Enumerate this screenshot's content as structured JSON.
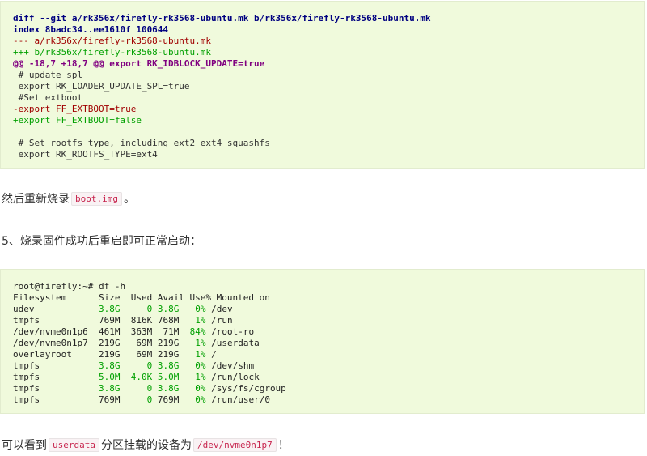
{
  "diff": {
    "header1": "diff --git a/rk356x/firefly-rk3568-ubuntu.mk b/rk356x/firefly-rk3568-ubuntu.mk",
    "header2": "index 8badc34..ee1610f 100644",
    "old_file": "--- a/rk356x/firefly-rk3568-ubuntu.mk",
    "new_file": "+++ b/rk356x/firefly-rk3568-ubuntu.mk",
    "hunk": "@@ -18,7 +18,7 @@ export RK_IDBLOCK_UPDATE=true",
    "ctx1": " # update spl",
    "ctx2": " export RK_LOADER_UPDATE_SPL=true",
    "ctx3": " #Set extboot",
    "del1": "-export FF_EXTBOOT=true",
    "add1": "+export FF_EXTBOOT=false",
    "ctx4": "",
    "ctx5": " # Set rootfs type, including ext2 ext4 squashfs",
    "ctx6": " export RK_ROOTFS_TYPE=ext4"
  },
  "para1": {
    "text_before": "然后重新烧录",
    "code": "boot.img",
    "text_after": "。"
  },
  "para2": {
    "text": "5、烧录固件成功后重启即可正常启动："
  },
  "df": {
    "prompt": "root@firefly:~# df -h",
    "header": "Filesystem      Size  Used Avail Use% Mounted on",
    "rows": [
      {
        "fs": "udev           ",
        "size": " 3.8G",
        "used": "     0",
        "avail": " 3.8G",
        "use": "   0%",
        "mount": " /dev"
      },
      {
        "fs": "tmpfs          ",
        "size": " 769M",
        "used": "  816K",
        "avail": " 768M",
        "use": "   1%",
        "mount": " /run"
      },
      {
        "fs": "/dev/nvme0n1p6 ",
        "size": " 461M",
        "used": "  363M",
        "avail": "  71M",
        "use": "  84%",
        "mount": " /root-ro"
      },
      {
        "fs": "/dev/nvme0n1p7 ",
        "size": " 219G",
        "used": "   69M",
        "avail": " 219G",
        "use": "   1%",
        "mount": " /userdata"
      },
      {
        "fs": "overlayroot    ",
        "size": " 219G",
        "used": "   69M",
        "avail": " 219G",
        "use": "   1%",
        "mount": " /"
      },
      {
        "fs": "tmpfs          ",
        "size": " 3.8G",
        "used": "     0",
        "avail": " 3.8G",
        "use": "   0%",
        "mount": " /dev/shm"
      },
      {
        "fs": "tmpfs          ",
        "size": " 5.0M",
        "used": "  4.0K",
        "avail": " 5.0M",
        "use": "   1%",
        "mount": " /run/lock"
      },
      {
        "fs": "tmpfs          ",
        "size": " 3.8G",
        "used": "     0",
        "avail": " 3.8G",
        "use": "   0%",
        "mount": " /sys/fs/cgroup"
      },
      {
        "fs": "tmpfs          ",
        "size": " 769M",
        "used": "     0",
        "avail": " 769M",
        "use": "   0%",
        "mount": " /run/user/0"
      }
    ]
  },
  "para3": {
    "text_before": "可以看到",
    "code1": "userdata",
    "text_mid": "分区挂载的设备为",
    "code2": "/dev/nvme0n1p7",
    "text_after": "！"
  },
  "colors": {
    "code_bg": "#f0fadc",
    "header": "#000080",
    "deleted": "#a00000",
    "added": "#00a000",
    "hunk": "#800080",
    "inline_code": "#c7254e"
  }
}
